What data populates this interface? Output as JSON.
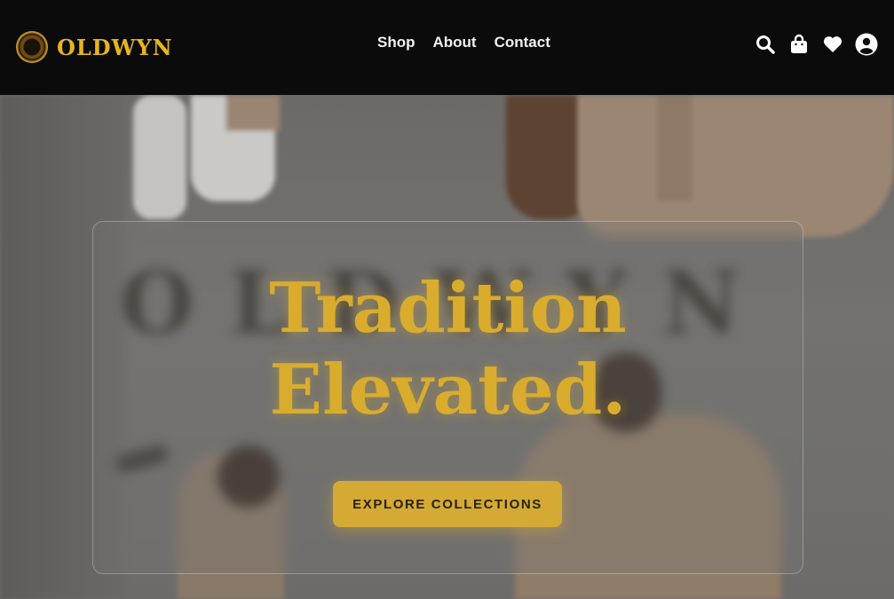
{
  "brand": {
    "name": "OLDWYN",
    "logo_icon": "sunburst-logo-icon"
  },
  "nav": {
    "links": [
      {
        "label": "Shop"
      },
      {
        "label": "About"
      },
      {
        "label": "Contact"
      }
    ],
    "icons": [
      "search-icon",
      "shopping-bag-icon",
      "heart-icon",
      "user-account-icon"
    ]
  },
  "hero": {
    "watermark": "OLDWYN",
    "headline_line1": "Tradition",
    "headline_line2": "Elevated.",
    "cta_label": "EXPLORE COLLECTIONS"
  },
  "colors": {
    "accent_gold": "#d9ac2e",
    "nav_background": "#0b0b0c",
    "nav_text": "#f2f2f2"
  }
}
